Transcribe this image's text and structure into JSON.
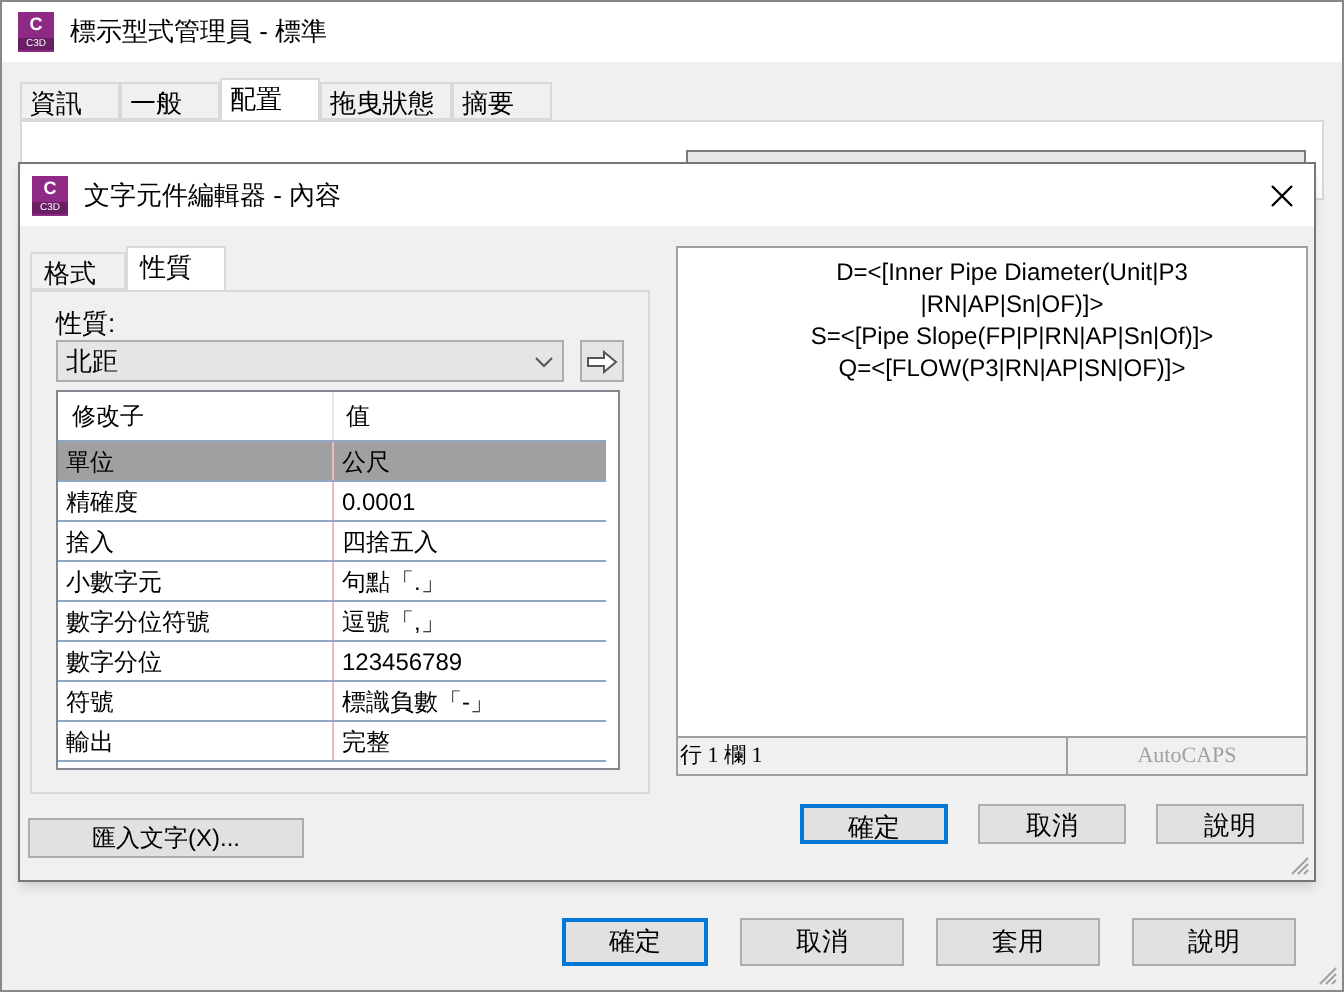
{
  "window": {
    "icon": {
      "letter": "C",
      "sub": "C3D"
    },
    "title": "標示型式管理員 - 標準",
    "tabs": [
      {
        "label": "資訊",
        "selected": false
      },
      {
        "label": "一般",
        "selected": false
      },
      {
        "label": "配置",
        "selected": true
      },
      {
        "label": "拖曳狀態",
        "selected": false
      },
      {
        "label": "摘要",
        "selected": false
      }
    ],
    "buttons": [
      {
        "label": "確定",
        "default": true
      },
      {
        "label": "取消",
        "default": false
      },
      {
        "label": "套用",
        "default": false
      },
      {
        "label": "說明",
        "default": false
      }
    ]
  },
  "editor": {
    "icon": {
      "letter": "C",
      "sub": "C3D"
    },
    "title": "文字元件編輯器 - 內容",
    "tabs": [
      {
        "label": "格式",
        "selected": false
      },
      {
        "label": "性質",
        "selected": true
      }
    ],
    "property_label": "性質:",
    "property_value": "北距",
    "table": {
      "columns": [
        "修改子",
        "值"
      ],
      "rows": [
        {
          "modifier": "單位",
          "value": "公尺",
          "selected": true
        },
        {
          "modifier": "精確度",
          "value": "0.0001",
          "selected": false
        },
        {
          "modifier": "捨入",
          "value": "四捨五入",
          "selected": false
        },
        {
          "modifier": "小數字元",
          "value": "句點「.」",
          "selected": false
        },
        {
          "modifier": "數字分位符號",
          "value": "逗號「,」",
          "selected": false
        },
        {
          "modifier": "數字分位",
          "value": "123456789",
          "selected": false
        },
        {
          "modifier": "符號",
          "value": "標識負數「-」",
          "selected": false
        },
        {
          "modifier": "輸出",
          "value": "完整",
          "selected": false
        }
      ]
    },
    "import_button": "匯入文字(X)...",
    "preview_lines": [
      "D=<[Inner Pipe Diameter(Unit|P3",
      "|RN|AP|Sn|OF)]>",
      "S=<[Pipe Slope(FP|P|RN|AP|Sn|Of)]>",
      "Q=<[FLOW(P3|RN|AP|SN|OF)]>"
    ],
    "status": {
      "position": "行 1 欄 1",
      "brand": "AutoCAPS"
    },
    "buttons": [
      {
        "label": "確定",
        "default": true
      },
      {
        "label": "取消",
        "default": false
      },
      {
        "label": "說明",
        "default": false
      }
    ]
  }
}
